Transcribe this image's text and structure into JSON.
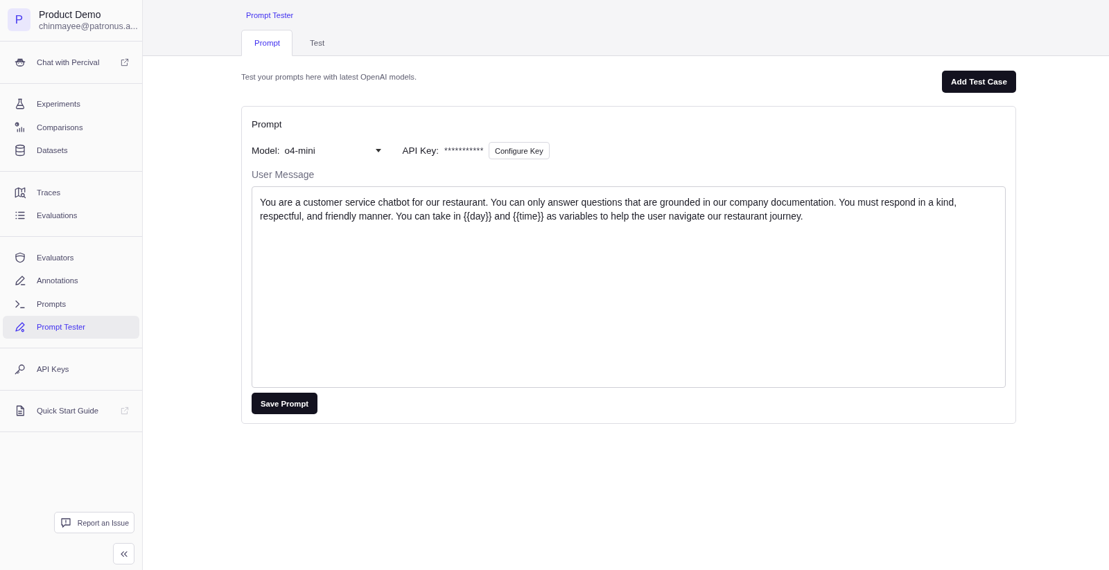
{
  "workspace": {
    "avatar_letter": "P",
    "name": "Product Demo",
    "email": "chinmayee@patronus.a..."
  },
  "sidebar": {
    "groups": [
      [
        {
          "label": "Chat with Percival",
          "selected": false,
          "external_link": true
        }
      ],
      [
        {
          "label": "Experiments",
          "selected": false,
          "external_link": false
        },
        {
          "label": "Comparisons",
          "selected": false,
          "external_link": false
        },
        {
          "label": "Datasets",
          "selected": false,
          "external_link": false
        }
      ],
      [
        {
          "label": "Traces",
          "selected": false,
          "external_link": false
        },
        {
          "label": "Evaluations",
          "selected": false,
          "external_link": false
        }
      ],
      [
        {
          "label": "Evaluators",
          "selected": false,
          "external_link": false
        },
        {
          "label": "Annotations",
          "selected": false,
          "external_link": false
        },
        {
          "label": "Prompts",
          "selected": false,
          "external_link": false
        },
        {
          "label": "Prompt Tester",
          "selected": true,
          "external_link": false
        }
      ],
      [
        {
          "label": "API Keys",
          "selected": false,
          "external_link": false
        }
      ],
      [
        {
          "label": "Quick Start Guide",
          "selected": false,
          "external_link": true
        }
      ]
    ],
    "report_button": "Report an Issue"
  },
  "breadcrumb": "Prompt Tester",
  "tabs": [
    {
      "label": "Prompt",
      "selected": true
    },
    {
      "label": "Test",
      "selected": false
    }
  ],
  "description": "Test your prompts here with latest OpenAI models.",
  "add_test_case_button": "Add Test Case",
  "prompt_card": {
    "title": "Prompt",
    "model_label": "Model:",
    "model_value": "o4-mini",
    "api_key_label": "API Key:",
    "api_key_value": "***********",
    "configure_key_button": "Configure Key",
    "user_message_label": "User Message",
    "user_message": "You are a customer service chatbot for our restaurant. You can only answer questions that are grounded in our company documentation. You must respond in a kind, respectful, and friendly manner. You can take in {{day}} and {{time}} as variables to help the user navigate our restaurant journey.",
    "save_button": "Save Prompt"
  }
}
